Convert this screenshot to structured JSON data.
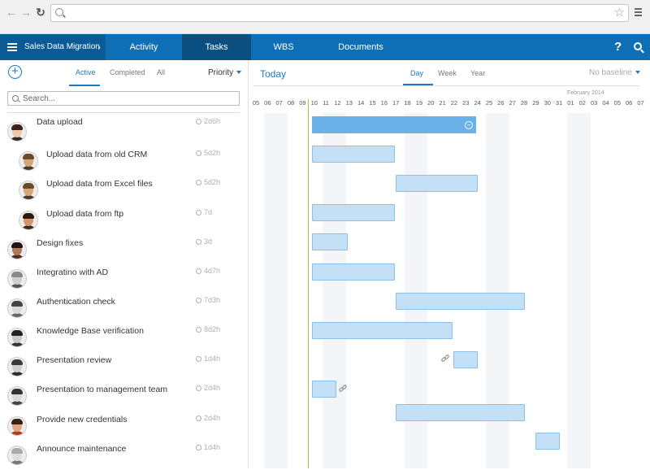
{
  "browser": {
    "url": "",
    "back_icon": "←",
    "forward_icon": "→",
    "reload_icon": "↻",
    "star_icon": "☆"
  },
  "appbar": {
    "project_name": "Sales Data Migration",
    "chevron": "›",
    "tabs": [
      "Activity",
      "Tasks",
      "WBS",
      "Documents"
    ],
    "active_tab": "Tasks",
    "help_icon": "?",
    "colors": {
      "bar": "#0e6fb6",
      "project": "#0a5a96",
      "active_tab": "#0b4f80"
    }
  },
  "left": {
    "add_icon": "+",
    "filters": [
      "Active",
      "Completed",
      "All"
    ],
    "active_filter": "Active",
    "sort_label": "Priority",
    "search_placeholder": "Search...",
    "tasks": [
      {
        "name": "Data upload",
        "duration": "2d6h",
        "avatar": "woman-dark-hair"
      },
      {
        "name": "Upload data from old CRM",
        "duration": "5d2h",
        "avatar": "man-glasses"
      },
      {
        "name": "Upload data from Excel files",
        "duration": "5d2h",
        "avatar": "man-glasses"
      },
      {
        "name": "Upload data from ftp",
        "duration": "7d",
        "avatar": "man-dark-hair"
      },
      {
        "name": "Design fixes",
        "duration": "3d",
        "avatar": "man-dark"
      },
      {
        "name": "Integratino with AD",
        "duration": "4d7h",
        "avatar": "man-gray"
      },
      {
        "name": "Authentication check",
        "duration": "7d3h",
        "avatar": "man-bw"
      },
      {
        "name": "Knowledge Base verification",
        "duration": "8d2h",
        "avatar": "man-bw-dark"
      },
      {
        "name": "Presentation review",
        "duration": "1d4h",
        "avatar": "man-bw-beard"
      },
      {
        "name": "Presentation to management team",
        "duration": "2d4h",
        "avatar": "man-bw-young"
      },
      {
        "name": "Provide new credentials",
        "duration": "2d4h",
        "avatar": "man-red-shirt"
      },
      {
        "name": "Announce maintenance",
        "duration": "1d4h",
        "avatar": "man-gray-bald"
      }
    ]
  },
  "gantt": {
    "today_label": "Today",
    "zoom_levels": [
      "Day",
      "Week",
      "Year"
    ],
    "active_zoom": "Day",
    "baseline_label": "No baseline",
    "month_label": "February 2014",
    "days": [
      "05",
      "06",
      "07",
      "08",
      "09",
      "10",
      "11",
      "12",
      "13",
      "14",
      "15",
      "16",
      "17",
      "18",
      "19",
      "20",
      "21",
      "22",
      "23",
      "24",
      "25",
      "26",
      "27",
      "28",
      "29",
      "30",
      "31",
      "01",
      "02",
      "03",
      "04",
      "05",
      "06",
      "07"
    ],
    "today_date": "10",
    "colors": {
      "bar": "#c4e0f6",
      "bar_border": "#8cc0e8",
      "summary": "#69b1e8",
      "today_line": "#f0a030",
      "weekend": "#f3f5f8"
    },
    "bars": [
      {
        "task": "Data upload",
        "start": "10",
        "end": "24",
        "summary": true
      },
      {
        "task": "Upload data from old CRM",
        "start": "10",
        "end": "17"
      },
      {
        "task": "Upload data from Excel files",
        "start": "17",
        "end": "24"
      },
      {
        "task": "Upload data from ftp",
        "start": "10",
        "end": "17"
      },
      {
        "task": "Design fixes",
        "start": "10",
        "end": "13"
      },
      {
        "task": "Integratino with AD",
        "start": "10",
        "end": "17"
      },
      {
        "task": "Authentication check",
        "start": "17",
        "end": "28"
      },
      {
        "task": "Knowledge Base verification",
        "start": "10",
        "end": "22"
      },
      {
        "task": "Presentation review",
        "start": "22",
        "end": "24",
        "linked": true
      },
      {
        "task": "Presentation to management team",
        "start": "10",
        "end": "12",
        "link_after": true
      },
      {
        "task": "Provide new credentials",
        "start": "17",
        "end": "28"
      },
      {
        "task": "Announce maintenance",
        "start": "29",
        "end": "31"
      }
    ]
  }
}
